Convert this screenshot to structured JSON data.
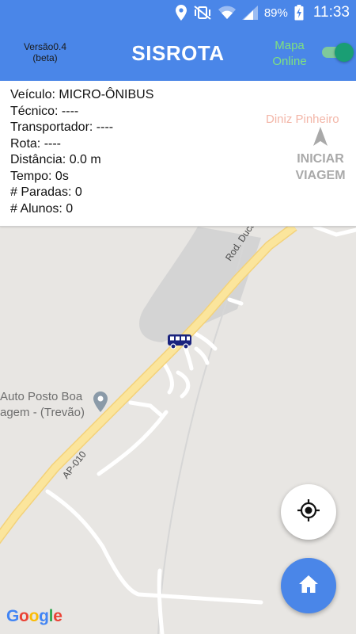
{
  "status_bar": {
    "battery": "89%",
    "time": "11:33"
  },
  "app_bar": {
    "version_line1": "Versão0.4",
    "version_line2": "(beta)",
    "title": "SISROTA",
    "map_online_line1": "Mapa",
    "map_online_line2": "Online",
    "map_online_enabled": true
  },
  "info": {
    "vehicle": "Veículo: MICRO-ÔNIBUS",
    "technician": "Técnico: ----",
    "carrier": "Transportador: ----",
    "route": "Rota: ----",
    "distance": "Distância: 0.0 m",
    "time": "Tempo: 0s",
    "stops": "# Paradas: 0",
    "students": "# Alunos: 0"
  },
  "start_trip": {
    "line1": "INICIAR",
    "line2": "VIAGEM"
  },
  "map": {
    "place_top": "Diniz Pinheiro",
    "road_duca_serra": "Rod. Duca Serra",
    "road_ap010": "AP-010",
    "poi_line1": "Auto Posto Boa",
    "poi_line2": "agem - (Trevão)",
    "attribution": "Google"
  },
  "icons": {
    "location": "location-pin-icon",
    "mute": "vibrate-mute-icon",
    "wifi": "wifi-icon",
    "signal": "signal-icon",
    "battery": "battery-charging-icon",
    "bus": "bus-icon",
    "navigation": "navigation-arrow-icon",
    "locate": "my-location-icon",
    "home": "home-icon",
    "poi": "poi-pin-icon"
  },
  "colors": {
    "primary": "#4a86e8",
    "map_online_text": "#7fe07f",
    "toggle_thumb": "#1a9e74",
    "road_main": "#fbe59c",
    "bus": "#1a237e"
  }
}
